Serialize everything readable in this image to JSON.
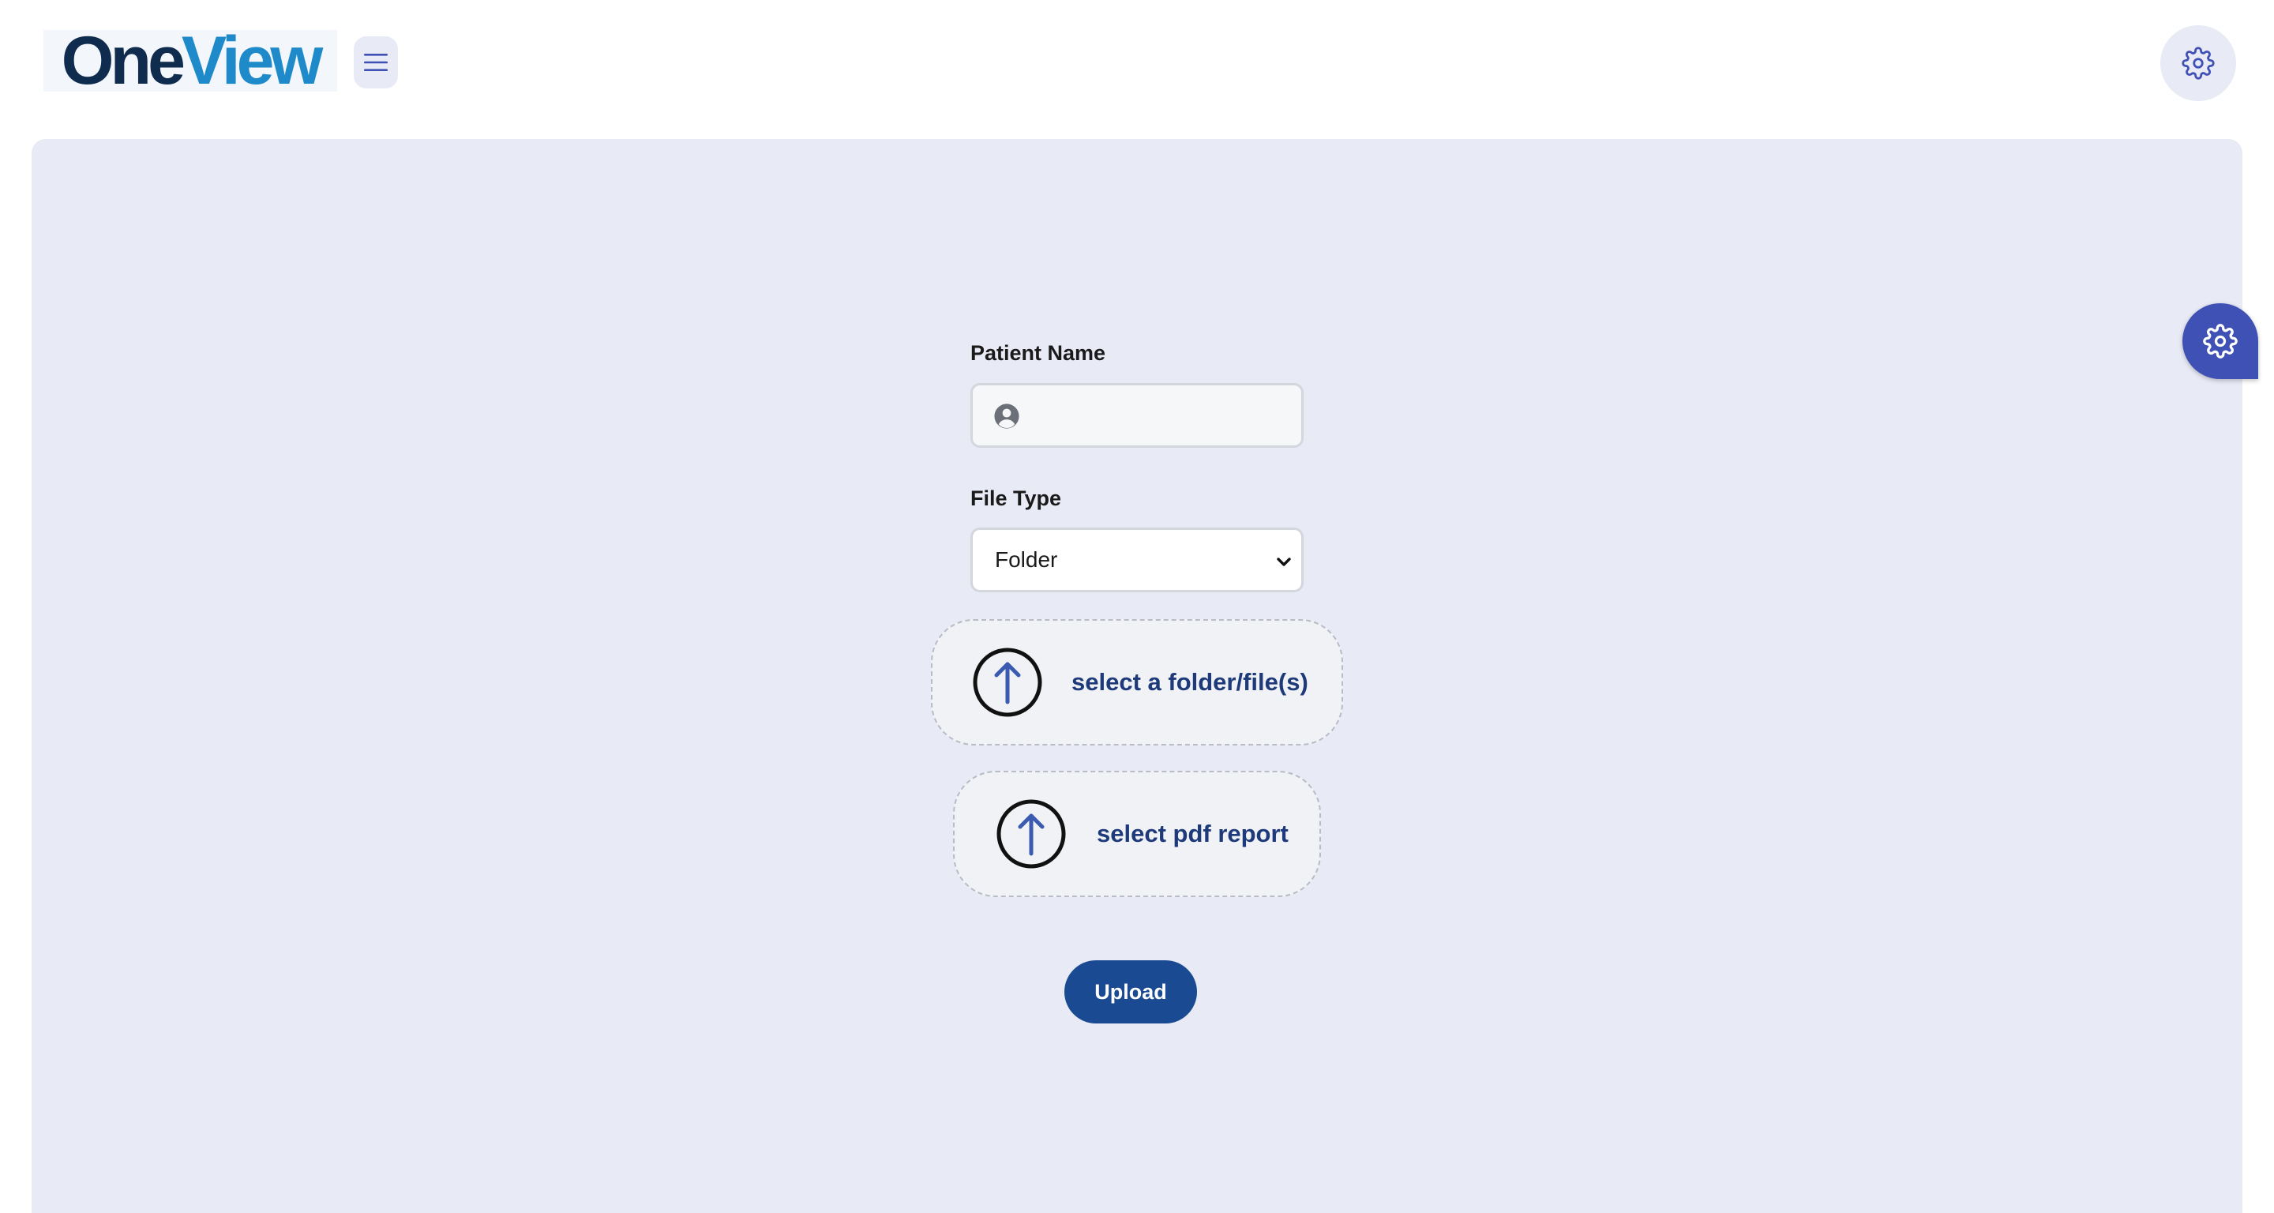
{
  "header": {
    "logo_part1": "One",
    "logo_part2": "View",
    "menu_icon": "hamburger-icon",
    "settings_icon": "gear-icon"
  },
  "form": {
    "patient_name_label": "Patient Name",
    "patient_name_value": "",
    "patient_name_icon": "user-circle-icon",
    "file_type_label": "File Type",
    "file_type_selected": "Folder",
    "folder_dropzone_label": "select a folder/file(s)",
    "pdf_dropzone_label": "select pdf report",
    "upload_label": "Upload"
  },
  "floating_settings_icon": "gear-icon",
  "colors": {
    "panel_bg": "#e8eaf6",
    "primary_button": "#1a4a91",
    "floating_button": "#3f51b5",
    "logo_dark": "#0f2c4f",
    "logo_light": "#1f8ac9",
    "dropzone_text": "#1e3a7a"
  }
}
